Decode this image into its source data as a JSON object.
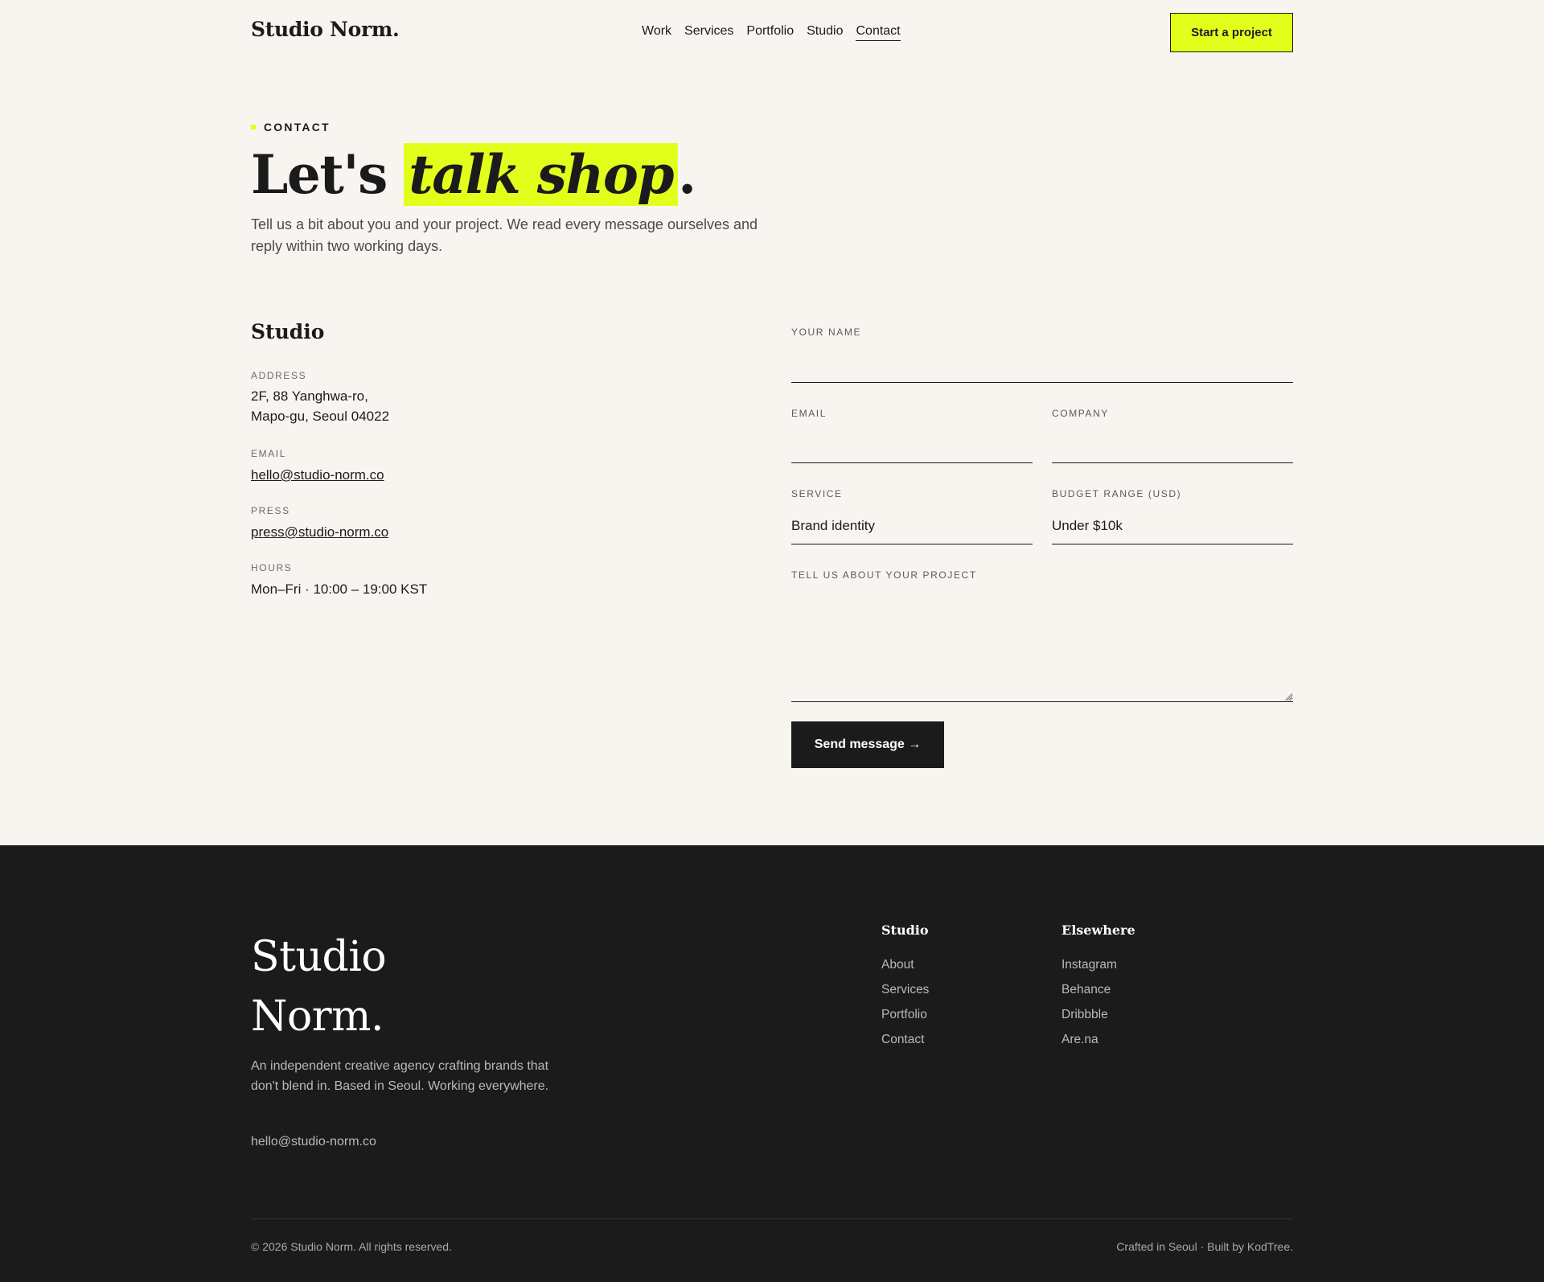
{
  "header": {
    "logo": "Studio Norm.",
    "nav": [
      {
        "label": "Work"
      },
      {
        "label": "Services"
      },
      {
        "label": "Portfolio"
      },
      {
        "label": "Studio"
      },
      {
        "label": "Contact",
        "active": true
      }
    ],
    "cta": "Start a project"
  },
  "hero": {
    "eyebrow": "CONTACT",
    "title_pre": "Let's ",
    "title_highlight": "talk shop",
    "title_post": ".",
    "subtitle": "Tell us a bit about you and your project. We read every message ourselves and reply within two working days."
  },
  "studio": {
    "title": "Studio",
    "address_label": "ADDRESS",
    "address_line1": "2F, 88 Yanghwa-ro,",
    "address_line2": "Mapo-gu, Seoul 04022",
    "email_label": "EMAIL",
    "email": "hello@studio-norm.co",
    "press_label": "PRESS",
    "press": "press@studio-norm.co",
    "hours_label": "HOURS",
    "hours": "Mon–Fri · 10:00 – 19:00 KST"
  },
  "form": {
    "name_label": "YOUR NAME",
    "name_value": "",
    "email_label": "EMAIL",
    "email_value": "",
    "company_label": "COMPANY",
    "company_value": "",
    "service_label": "SERVICE",
    "service_value": "Brand identity",
    "budget_label": "BUDGET RANGE (USD)",
    "budget_value": "Under $10k",
    "project_label": "TELL US ABOUT YOUR PROJECT",
    "submit": "Send message →"
  },
  "footer": {
    "logo_line1": "Studio",
    "logo_line2": "Norm.",
    "description": "An independent creative agency crafting brands that don't blend in. Based in Seoul. Working everywhere.",
    "email": "hello@studio-norm.co",
    "col1_title": "Studio",
    "col1_links": [
      "About",
      "Services",
      "Portfolio",
      "Contact"
    ],
    "col2_title": "Elsewhere",
    "col2_links": [
      "Instagram",
      "Behance",
      "Dribbble",
      "Are.na"
    ],
    "copyright": "© 2026 Studio Norm. All rights reserved.",
    "credit": "Crafted in Seoul · Built by KodTree."
  },
  "colors": {
    "background": "#f8f5f1",
    "accent": "#e2ff1c",
    "ink": "#1b1b1b",
    "footer_bg": "#1b1b1b"
  }
}
